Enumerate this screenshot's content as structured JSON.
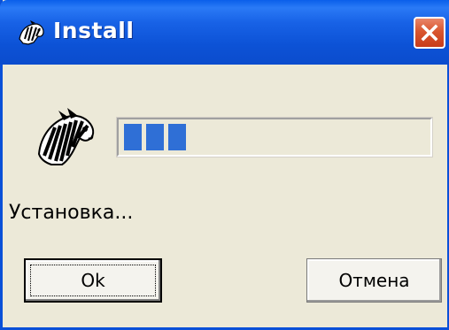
{
  "window": {
    "title": "Install"
  },
  "progress": {
    "filled_blocks": 3,
    "fraction": 0.19,
    "color": "#2f6fd6"
  },
  "status": {
    "text": "Установка..."
  },
  "buttons": {
    "ok_label": "Ok",
    "cancel_label": "Отмена"
  },
  "icons": {
    "title_icon": "zebra-icon",
    "main_icon": "zebra-icon",
    "close_icon": "close-icon"
  },
  "colors": {
    "titlebar": "#0c52d6",
    "dialog_background": "#ece9d8",
    "close_button": "#d9562f"
  }
}
